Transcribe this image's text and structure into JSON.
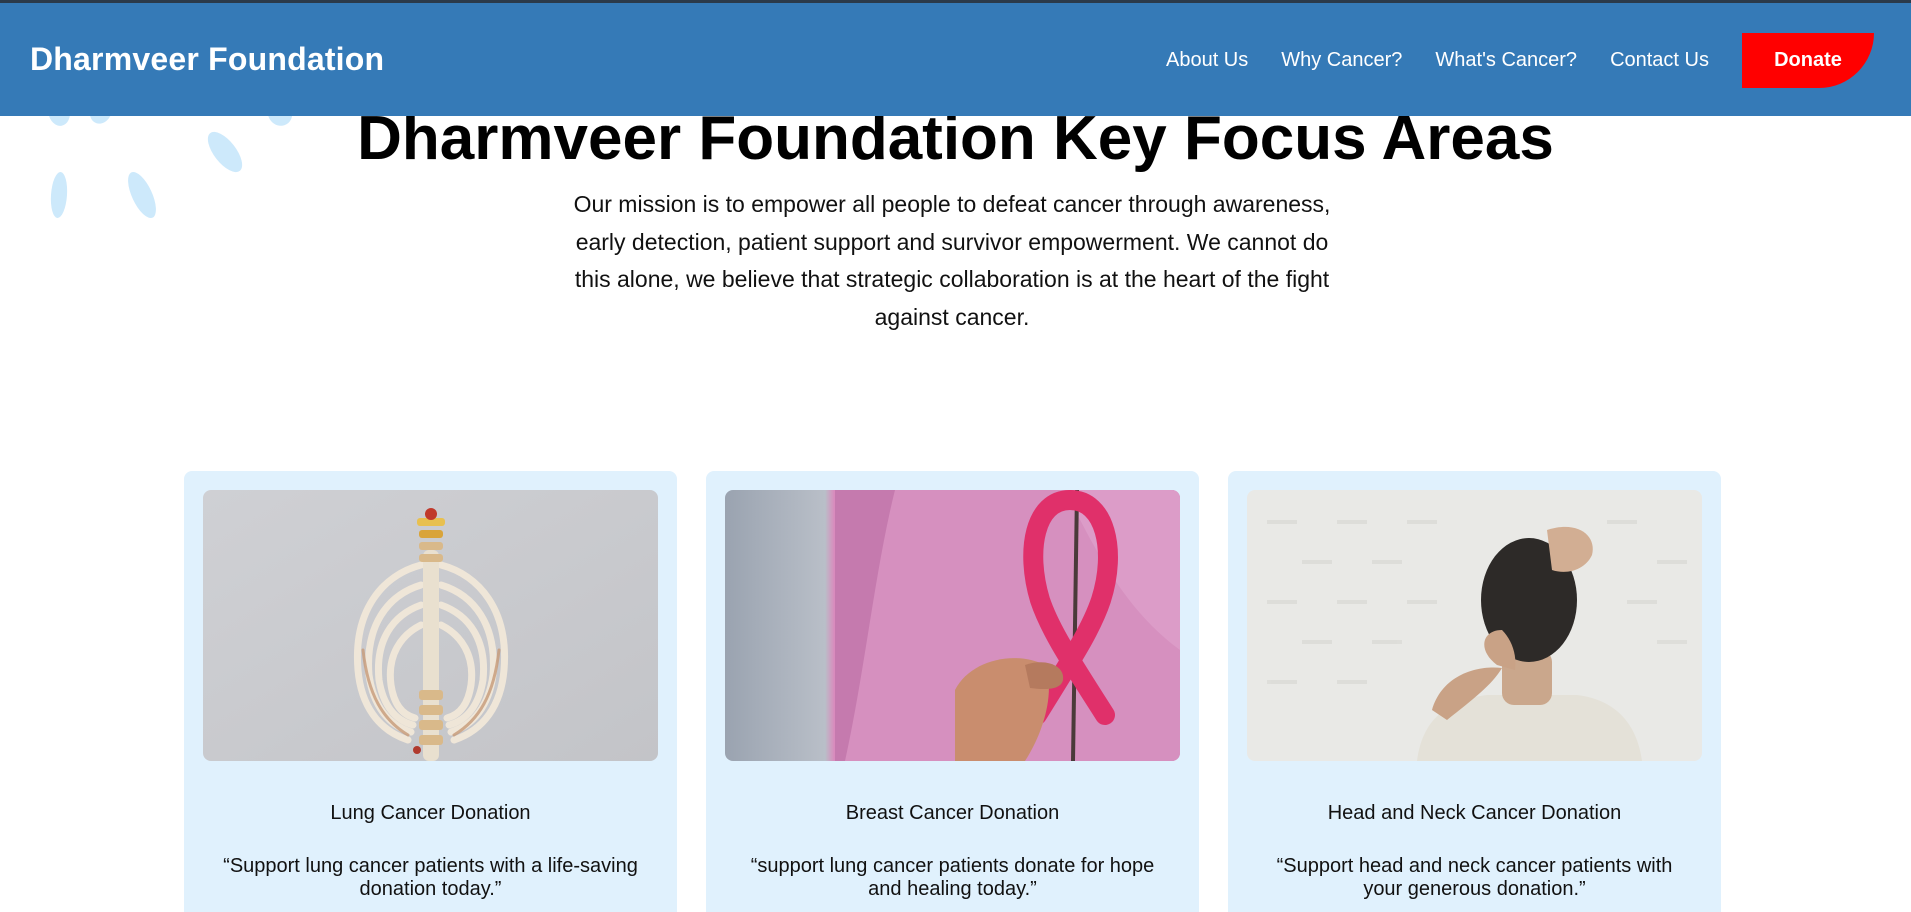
{
  "header": {
    "brand": "Dharmveer Foundation",
    "nav": [
      "About Us",
      "Why Cancer?",
      "What's Cancer?",
      "Contact Us"
    ],
    "donate_label": "Donate"
  },
  "colors": {
    "header_bg": "#357ab7",
    "donate_bg": "#ff0000",
    "card_bg": "#e0f1fd",
    "petal": "#cde9fb"
  },
  "focus": {
    "title": "Dharmveer Foundation Key Focus Areas",
    "mission": "Our mission is to empower all people to defeat cancer through awareness, early detection, patient support and survivor empowerment. We cannot do this alone, we believe that strategic collaboration is at the heart of the fight against cancer."
  },
  "cards": [
    {
      "image": "ribcage-spine-model-image",
      "title": "Lung Cancer Donation",
      "quote": "“Support lung cancer patients with a life-saving donation today.”"
    },
    {
      "image": "pink-ribbon-image",
      "title": "Breast Cancer Donation",
      "quote": "“support lung cancer patients donate for hope and healing today.”"
    },
    {
      "image": "neck-pain-person-image",
      "title": "Head and Neck Cancer Donation",
      "quote": "“Support head and neck cancer patients with your generous donation.”"
    }
  ]
}
